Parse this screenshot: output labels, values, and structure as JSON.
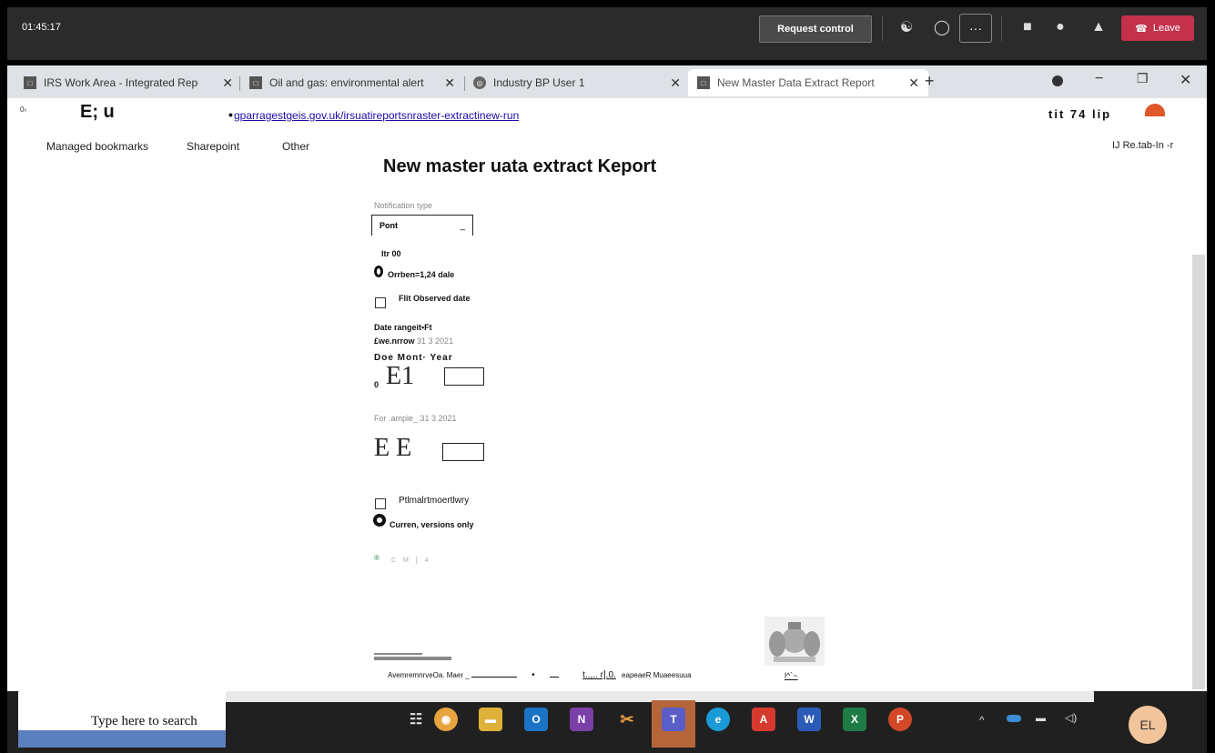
{
  "callbar": {
    "time": "01:45:17",
    "request_control": "Request control",
    "more": "···",
    "leave": "Leave",
    "icons": [
      "people-icon",
      "chat-icon",
      "camera-off-icon",
      "mic-icon",
      "share-icon"
    ]
  },
  "tabs": [
    {
      "label": "IRS Work Area - Integrated Repo",
      "active": false
    },
    {
      "label": "Oil and gas: environmental alerts",
      "active": false
    },
    {
      "label": "Industry BP User 1",
      "active": false
    },
    {
      "label": "New Master Data Extract Report",
      "active": true
    }
  ],
  "address": {
    "prefix": "E; u",
    "url": "gparragestgeis.gov.uk/irsuatireportsnraster-extractinew-run",
    "right_text": "tit 74 lip"
  },
  "bookmarks": {
    "items": [
      "Managed bookmarks",
      "Sharepoint",
      "Other"
    ],
    "right": "IJ Re.tab-In -r"
  },
  "form": {
    "title": "New master uata extract Keport",
    "notification_label": "Notification type",
    "notification_value": "Pont",
    "itr": "Itr 00",
    "orrben": "Orrben=1,24 dale",
    "filt_observed": "Flit Observed date",
    "date_range": "Date rangeit•Ft",
    "example1_label": "£we.nrrow",
    "example1_value": "31 3 2021",
    "doe_month_year": "Doe Mont· Year",
    "field_a_prefix": "0",
    "field_a": "E1",
    "example2": "For .ample_ 31 3 2021",
    "field_b": "E E",
    "primary_check": "Ptlmalrtmoertlwry",
    "current_versions": "Curren, versions only",
    "run_button": "C M [ 4"
  },
  "footer": {
    "text": "AvemremnrveOa. Maer _",
    "mid1": "•",
    "mid2": "t..,.. r].0.",
    "mid3": "eapeaeR Muaeesuua",
    "crest_caption": "l^`~"
  },
  "taskbar": {
    "search": "Type here to search",
    "avatar": "EL"
  }
}
